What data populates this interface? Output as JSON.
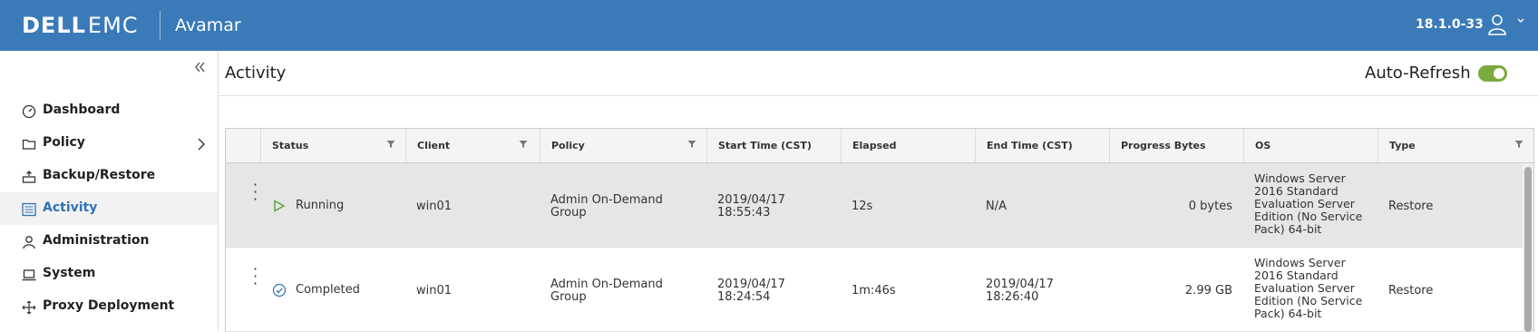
{
  "header": {
    "logo_dell": "DELL",
    "logo_emc": "EMC",
    "app_name": "Avamar",
    "version": "18.1.0-33",
    "user_icon": "user-icon",
    "colors": {
      "bar": "#3a7ab8"
    }
  },
  "sidebar": {
    "items": [
      {
        "label": "Dashboard",
        "icon": "dashboard-icon"
      },
      {
        "label": "Policy",
        "icon": "folder-icon"
      },
      {
        "label": "Backup/Restore",
        "icon": "backup-icon"
      },
      {
        "label": "Activity",
        "icon": "activity-icon"
      },
      {
        "label": "Administration",
        "icon": "person-icon"
      },
      {
        "label": "System",
        "icon": "laptop-icon"
      },
      {
        "label": "Proxy Deployment",
        "icon": "proxy-icon"
      }
    ],
    "active": "Activity",
    "active_color": "#2f72b5"
  },
  "main": {
    "title": "Activity",
    "auto_refresh_label": "Auto-Refresh",
    "auto_refresh_on": true
  },
  "table": {
    "columns": [
      "Status",
      "Client",
      "Policy",
      "Start Time (CST)",
      "Elapsed",
      "End Time (CST)",
      "Progress Bytes",
      "OS",
      "Type"
    ],
    "rows": [
      {
        "status": "Running",
        "client": "win01",
        "policy_l1": "Admin On-Demand",
        "policy_l2": "Group",
        "start_l1": "2019/04/17",
        "start_l2": "18:55:43",
        "elapsed": "12s",
        "end_l1": "N/A",
        "end_l2": "",
        "progress": "0 bytes",
        "os_l1": "Windows Server",
        "os_l2": "2016 Standard",
        "os_l3": "Evaluation Server",
        "os_l4": "Edition (No Service",
        "os_l5": "Pack) 64-bit",
        "type": "Restore"
      },
      {
        "status": "Completed",
        "client": "win01",
        "policy_l1": "Admin On-Demand",
        "policy_l2": "Group",
        "start_l1": "2019/04/17",
        "start_l2": "18:24:54",
        "elapsed": "1m:46s",
        "end_l1": "2019/04/17",
        "end_l2": "18:26:40",
        "progress": "2.99 GB",
        "os_l1": "Windows Server",
        "os_l2": "2016 Standard",
        "os_l3": "Evaluation Server",
        "os_l4": "Edition (No Service",
        "os_l5": "Pack) 64-bit",
        "type": "Restore"
      }
    ],
    "colors": {
      "running": "#5a9e3a",
      "completed": "#2f72b5"
    }
  }
}
